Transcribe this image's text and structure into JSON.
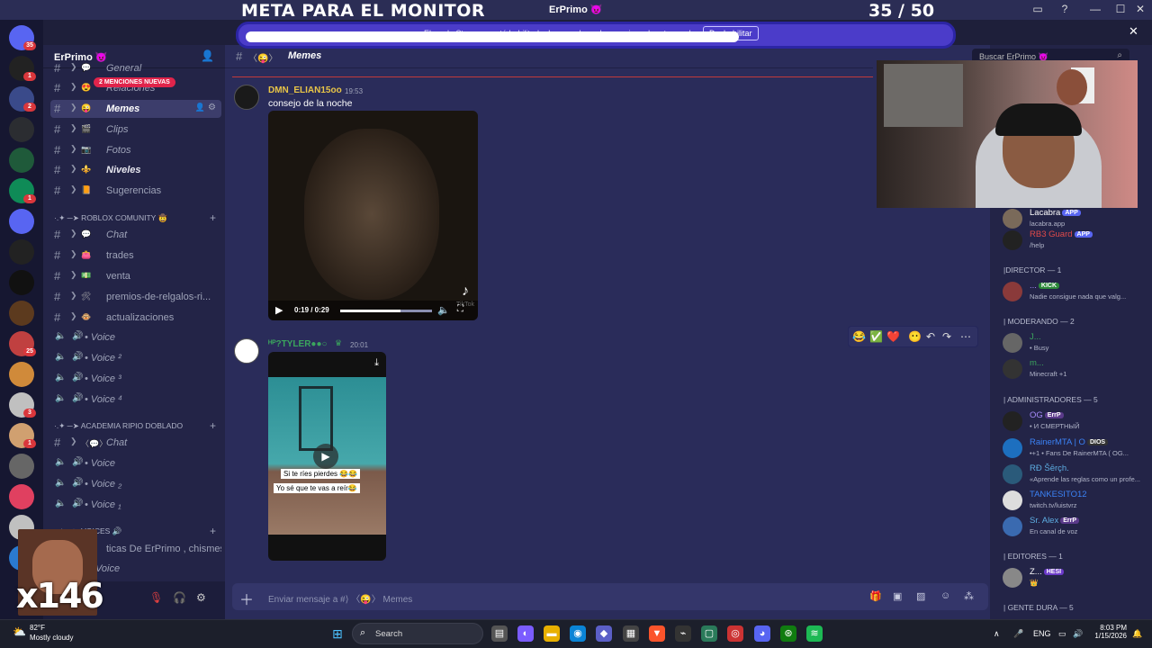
{
  "overlay": {
    "stream_goal": "META PARA EL MONITOR",
    "goal_count": "35 / 50",
    "cam_counter": "x146"
  },
  "window": {
    "title": "ErPrimo 😈",
    "controls": [
      "▭",
      "?",
      "—",
      "☐",
      "✕"
    ]
  },
  "banner": {
    "text": "El modo Streamer está habilitado. Los nombres de usuario se han truncado.",
    "button": "Deshabilitar",
    "close": "✕"
  },
  "servers": [
    {
      "badge": "35",
      "color": "#5865f2"
    },
    {
      "badge": "1",
      "color": "#222"
    },
    {
      "badge": "2",
      "color": "#3a4a8a"
    },
    {
      "badge": "",
      "color": "#2b2d31"
    },
    {
      "badge": "",
      "color": "#1f5a3a"
    },
    {
      "badge": "1",
      "color": "#0f8b57"
    },
    {
      "badge": "",
      "color": "#5865f2"
    },
    {
      "badge": "",
      "color": "#222"
    },
    {
      "badge": "",
      "color": "#111"
    },
    {
      "badge": "",
      "color": "#5c3a1e"
    },
    {
      "badge": "25",
      "color": "#c04040"
    },
    {
      "badge": "",
      "color": "#d08a3a"
    },
    {
      "badge": "3",
      "color": "#c0c0c0"
    },
    {
      "badge": "1",
      "color": "#d0a070"
    },
    {
      "badge": "",
      "color": "#666"
    },
    {
      "badge": "",
      "color": "#e04060"
    },
    {
      "badge": "",
      "color": "#c0c0c0"
    },
    {
      "badge": "",
      "color": "#2a7ad0"
    }
  ],
  "guild": {
    "name": "ErPrimo 😈",
    "mentions_pill": "2 MENCIONES NUEVAS",
    "channels_top": [
      {
        "label": "General",
        "emoji": "💬",
        "style": "italic"
      },
      {
        "label": "Relaciones",
        "emoji": "😍",
        "style": "italic"
      },
      {
        "label": "Memes",
        "emoji": "😜",
        "style": "active"
      },
      {
        "label": "Clips",
        "emoji": "🎬",
        "style": "italic"
      },
      {
        "label": "Fotos",
        "emoji": "📷",
        "style": "italic"
      },
      {
        "label": "Niveles",
        "emoji": "⚜️",
        "style": "bold"
      },
      {
        "label": "Sugerencias",
        "emoji": "📙",
        "style": "plain"
      }
    ],
    "category_roblox": "·.✦ ─➤ ROBLOX COMUNITY 🤠",
    "channels_roblox": [
      {
        "label": "Chat",
        "emoji": "💬",
        "style": "italic"
      },
      {
        "label": "trades",
        "emoji": "👛",
        "style": "plain"
      },
      {
        "label": "venta",
        "emoji": "💵",
        "style": "plain"
      },
      {
        "label": "premios-de-relgalos-ri...",
        "emoji": "🛠",
        "style": "plain"
      },
      {
        "label": "actualizaciones",
        "emoji": "🐵",
        "style": "plain"
      }
    ],
    "voice_roblox": [
      "• Voice",
      "• Voice ²",
      "• Voice ³",
      "• Voice ⁴"
    ],
    "category_academia": "·.✦ ─➤ ACADEMIA RIPIO DOBLADO",
    "academia_chat": "Chat",
    "voice_academia": [
      "• Voice",
      "• Voice ₂",
      "• Voice ₁"
    ],
    "category_voices": "·.✦ ─➤ VOICES 🔊",
    "voices_text": "ticas De ErPrimo , chismes...",
    "voices_voice": "Voice"
  },
  "chat": {
    "channel_name": "Memes",
    "messages": [
      {
        "author": "DMN_ELIAN15oo",
        "author_color": "#e8c547",
        "time": "19:53",
        "text": "consejo de la noche",
        "video_time": "0:19 / 0:29",
        "progress": 0.66,
        "watermark": "TikTok"
      },
      {
        "author": "ᴴᴾ?TYLER●●○",
        "author_color": "#3ba55d",
        "time": "20:01",
        "caption1": "Si te ríes pierdes 😂😂",
        "caption2": "Yo sé que te vas a reír😂"
      }
    ],
    "reactions": [
      "😂",
      "✅",
      "❤️",
      "😶",
      "↶",
      "↷",
      "⋯"
    ],
    "composer_placeholder": "Enviar mensaje a #⟩ 〈😜〉 Memes"
  },
  "members": {
    "search_placeholder": "Buscar ErPrimo 😈",
    "rows": [
      {
        "name": "Lacabra",
        "status": "lacabra.app",
        "color": "#ffffff",
        "tag": "APP",
        "tag_color": "#5865f2"
      },
      {
        "name": "RB3 Guard",
        "status": "/help",
        "color": "#e04a4a",
        "tag": "APP",
        "tag_color": "#5865f2"
      }
    ],
    "group_director": "|DIRECTOR — 1",
    "director": {
      "name": "...",
      "status": "Nadie consigue nada que valg...",
      "tag": "KICK",
      "tag_color": "#2d8a3a"
    },
    "group_moderando": "| MODERANDO — 2",
    "moderators": [
      {
        "name": "J...",
        "status": "• Busy",
        "color": "#3ba55d"
      },
      {
        "name": "m...",
        "status": "Minecraft +1",
        "color": "#3ba55d"
      }
    ],
    "group_admins": "| ADMINISTRADORES — 5",
    "admins": [
      {
        "name": "OG",
        "status": "• И СМЕРТНЫЙ",
        "color": "#a78bfa",
        "tag": "ErrP"
      },
      {
        "name": "RainerMTA | O",
        "status": "•+1 • Fans De RainerMTA ( OG...",
        "color": "#3b82f6",
        "tag": "DIOS"
      },
      {
        "name": "RÐ Šērçh.",
        "status": "«Aprende las reglas como un profe...",
        "color": "#5dade2",
        "tag": ""
      },
      {
        "name": "TANKESITO12",
        "status": "twitch.tv/luistvrz",
        "color": "#3b82f6",
        "tag": ""
      },
      {
        "name": "Sr. Alex",
        "status": "En canal de voz",
        "color": "#5dade2",
        "tag": "ErrP"
      }
    ],
    "group_editores": "| EDITORES — 1",
    "editor": {
      "name": "Z...",
      "status": "👑",
      "tag": "HESI"
    },
    "group_gente": "| GENTE DURA — 5"
  },
  "taskbar": {
    "weather_temp": "82°F",
    "weather_desc": "Mostly cloudy",
    "search": "Search",
    "lang": "ENG",
    "time": "8:03 PM",
    "date": "1/15/2026"
  }
}
